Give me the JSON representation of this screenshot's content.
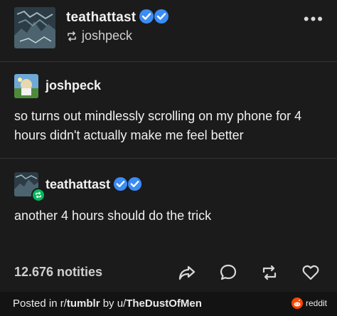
{
  "post": {
    "reblogger": "teathattast",
    "reblogged_from": "joshpeck",
    "original": {
      "author": "joshpeck",
      "text": "so turns out mindlessly scrolling on my phone for 4 hours didn't actually make me feel better"
    },
    "reply": {
      "author": "teathattast",
      "text": "another 4 hours should do the trick"
    },
    "notes": "12.676 notities"
  },
  "footer": {
    "prefix": "Posted in r/",
    "subreddit": "tumblr",
    "by": " by u/",
    "user": "TheDustOfMen",
    "brand": "reddit"
  },
  "colors": {
    "background": "#1b1b1b",
    "verified": "#3b8cf5",
    "reblog_green": "#00b85c",
    "reddit_orange": "#ff4500"
  },
  "icons": [
    "reblog-icon",
    "verified-icon",
    "share-icon",
    "reply-icon",
    "reblog-action-icon",
    "like-icon",
    "more-icon",
    "reddit-icon"
  ]
}
